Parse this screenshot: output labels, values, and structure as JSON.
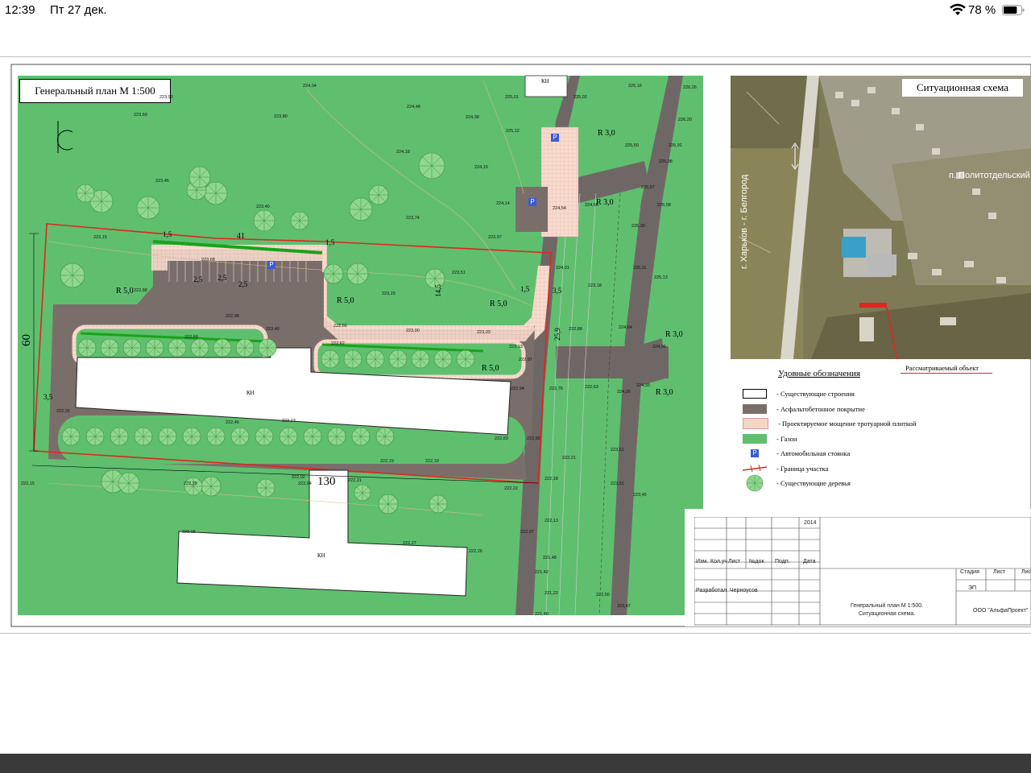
{
  "status_bar": {
    "time": "12:39",
    "date": "Пт 27 дек.",
    "battery_percent": "78 %",
    "battery_level": 0.78
  },
  "plan": {
    "title": "Генеральный план М 1:500",
    "dim_width": "130",
    "dim_height": "60",
    "building_label": "КН",
    "labels": {
      "r5_left": "R 5,0",
      "r5_mid1": "R 5,0",
      "r5_mid2": "R 5,0",
      "r5_right": "R 5,0",
      "r3_top": "R 3,0",
      "r3_road": "R 3,0",
      "r3_right1": "R 3,0",
      "r3_right2": "R 3,0",
      "d41": "41",
      "d15a": "1,5",
      "d15b": "1,5",
      "d25a": "2,5",
      "d25b": "2,5",
      "d25c": "2,5",
      "d35": "3,5",
      "d35b": "3,5",
      "d35c": "3,5",
      "d14": "14,5",
      "d259": "25,9",
      "d15c": "1,5"
    },
    "elevations": [
      "223,90",
      "224,04",
      "224,48",
      "224,38",
      "225,01",
      "225,16",
      "225,02",
      "226,26",
      "223,69",
      "223,80",
      "224,18",
      "224,15",
      "225,12",
      "226,20",
      "225,50",
      "225,91",
      "225,98",
      "223,46",
      "223,40",
      "223,74",
      "224,14",
      "224,54",
      "224,66",
      "225,57",
      "225,58",
      "223,15",
      "223,97",
      "223,68",
      "225,39",
      "225,11",
      "223,51",
      "223,29",
      "224,01",
      "223,18",
      "225,13",
      "222,88",
      "222,98",
      "222,66",
      "223,40",
      "224,64",
      "224,96",
      "222,60",
      "222,62",
      "223,00",
      "223,03",
      "223,13",
      "222,88",
      "222,97",
      "222,76",
      "222,63",
      "224,26",
      "222,94",
      "224,33",
      "222,25",
      "222,46",
      "222,13",
      "222,83",
      "222,82",
      "223,51",
      "222,15",
      "222,19",
      "222,02",
      "222,21",
      "222,22",
      "222,18",
      "222,21",
      "223,51",
      "222,25",
      "222,04",
      "222,19",
      "222,07",
      "222,13",
      "223,45",
      "222,15",
      "222,27",
      "222,26",
      "221,48",
      "221,42",
      "221,22",
      "222,50",
      "222,47",
      "221,40"
    ],
    "map_markers": {
      "a": "А",
      "p": "P"
    }
  },
  "situation": {
    "title": "Ситуационная схема",
    "road_label": "г. Харьков - г. Белгород",
    "village_label": "п. Политотдельский",
    "object_label": "Рассматриваемый объект"
  },
  "legend": {
    "title": "Удовные обозначения",
    "items": [
      {
        "key": "existing_buildings",
        "label": "- Существующие строения"
      },
      {
        "key": "asphalt",
        "label": "- Асфальтобетонное покрытие"
      },
      {
        "key": "paving",
        "label": "- Проектируемое мощение тротуарной плиткой"
      },
      {
        "key": "lawn",
        "label": "- Газон"
      },
      {
        "key": "parking",
        "label": "- Автомобильная стоянка",
        "symbol": "P"
      },
      {
        "key": "boundary",
        "label": "- Граница участка"
      },
      {
        "key": "trees",
        "label": "- Существующие деревья"
      }
    ]
  },
  "title_block": {
    "year": "2014",
    "headers": [
      "Изм.",
      "Кол.уч",
      "Лист",
      "№док",
      "Подп.",
      "Дата"
    ],
    "developer_role": "Разработал",
    "developer_name": "Черноусов",
    "stage_header": "Стадия",
    "sheet_header": "Лист",
    "sheets_header": "Листов",
    "stage_value": "ЭП",
    "drawing_name_1": "Генеральный план М 1:500.",
    "drawing_name_2": "Ситуационная схема.",
    "company": "ООО \"АльфаПроект\""
  },
  "colors": {
    "lawn": "#5fbf6f",
    "asphalt": "#7a6e6a",
    "paving": "#f3d6c6",
    "boundary": "#e0261f",
    "tree": "#8fd78f",
    "road": "#6f6766"
  }
}
